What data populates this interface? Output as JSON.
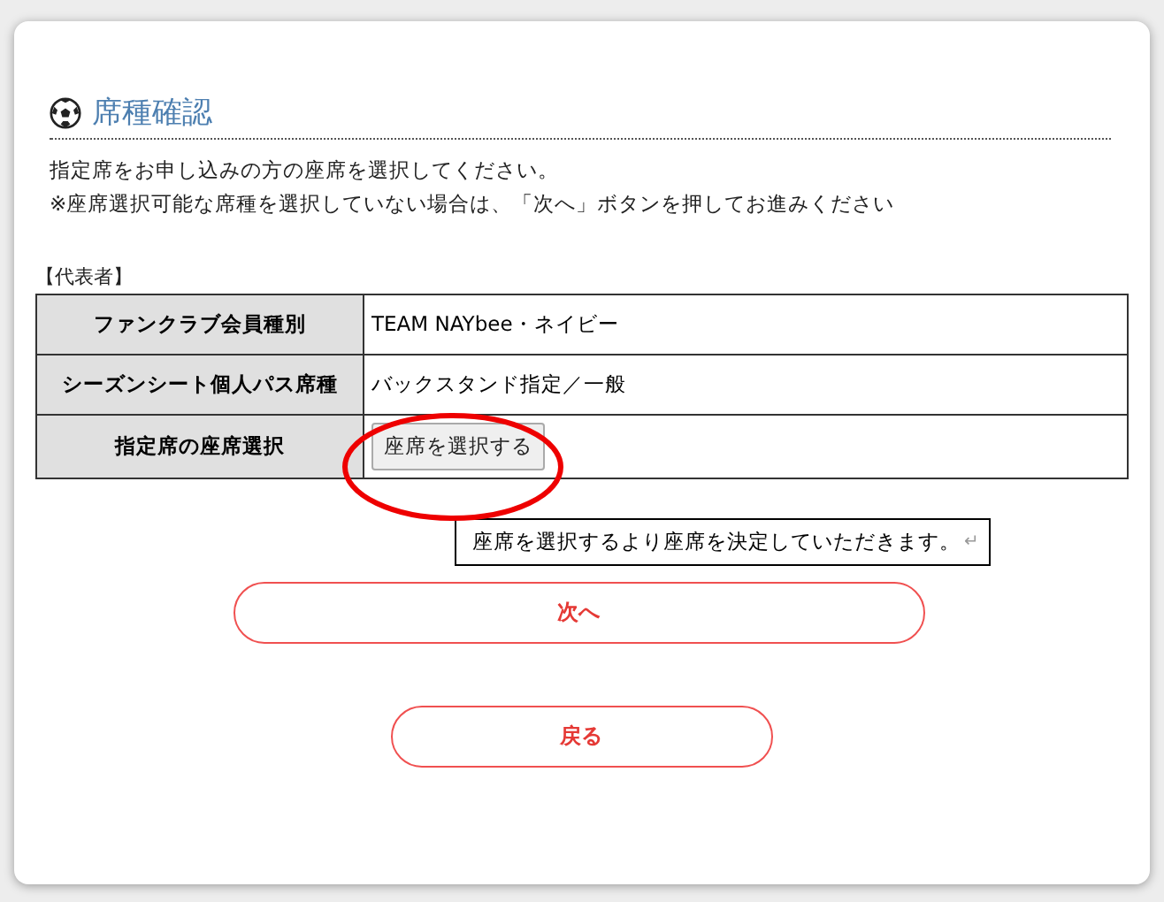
{
  "heading": "席種確認",
  "instructions": [
    "指定席をお申し込みの方の座席を選択してください。",
    "※座席選択可能な席種を選択していない場合は、「次へ」ボタンを押してお進みください"
  ],
  "section_label": "【代表者】",
  "rows": [
    {
      "kind": "text",
      "label": "ファンクラブ会員種別",
      "value": "TEAM NAYbee・ネイビー"
    },
    {
      "kind": "text",
      "label": "シーズンシート個人パス席種",
      "value": "バックスタンド指定／一般"
    },
    {
      "kind": "button",
      "label": "指定席の座席選択",
      "value": "座席を選択する"
    }
  ],
  "callout": {
    "text": "座席を選択するより座席を決定していただきます。",
    "return_mark": "↵"
  },
  "buttons": [
    "次へ",
    "戻る"
  ]
}
